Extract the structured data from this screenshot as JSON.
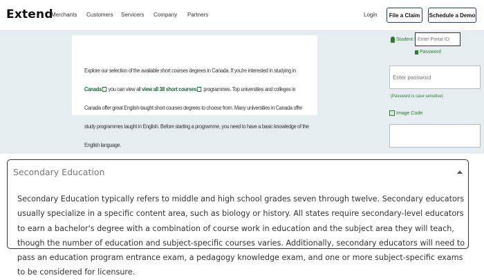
{
  "nav": {
    "logo": "Extend",
    "links": [
      "Merchants",
      "Customers",
      "Servicers",
      "Company",
      "Partners"
    ],
    "login": "Login",
    "file_claim": "File a Claim",
    "schedule_demo": "Schedule a Demo"
  },
  "hero": {
    "text_1": "Explore our selection of the available short courses degrees in Canada. If you're interested in studying in ",
    "link_1": "Canada",
    "text_2": " you can view all ",
    "link_2": "view all 38 short courses",
    "text_3": " programmes. Top universities and colleges in Canada offer great English-taught short courses degrees to choose from. Many universities in Canada offer study programmes taught in English. Before starting a programme, you need to have a basic knowledge of the English language."
  },
  "login_panel": {
    "student_label": "Student ID",
    "portal_placeholder": "Enter Portal ID",
    "password_label": "Password",
    "password_placeholder": "Enter password",
    "case_note": "(Password is case sensitive)",
    "image_code_label": "Image Code"
  },
  "accordion": {
    "title": "Secondary Education",
    "body": "Secondary Education typically refers to middle and high school grades seven through twelve. Secondary educators usually specialize in a specific content area, such as biology or history. All states require secondary-level educators to earn a bachelor's degree with a combination of course work in education and the subject area they will teach, though the number of education and subject-specific courses varies. Additionally, secondary educators will need to pass an education program entrance exam, a pedagogy knowledge exam, and one or more subject-specific exams to be considered for licensure."
  },
  "colors": {
    "brand_green": "#2c7a2c",
    "link_green": "#1a6b3a",
    "button_border": "#1f3a93",
    "hero_bg": "#e5edf0"
  }
}
